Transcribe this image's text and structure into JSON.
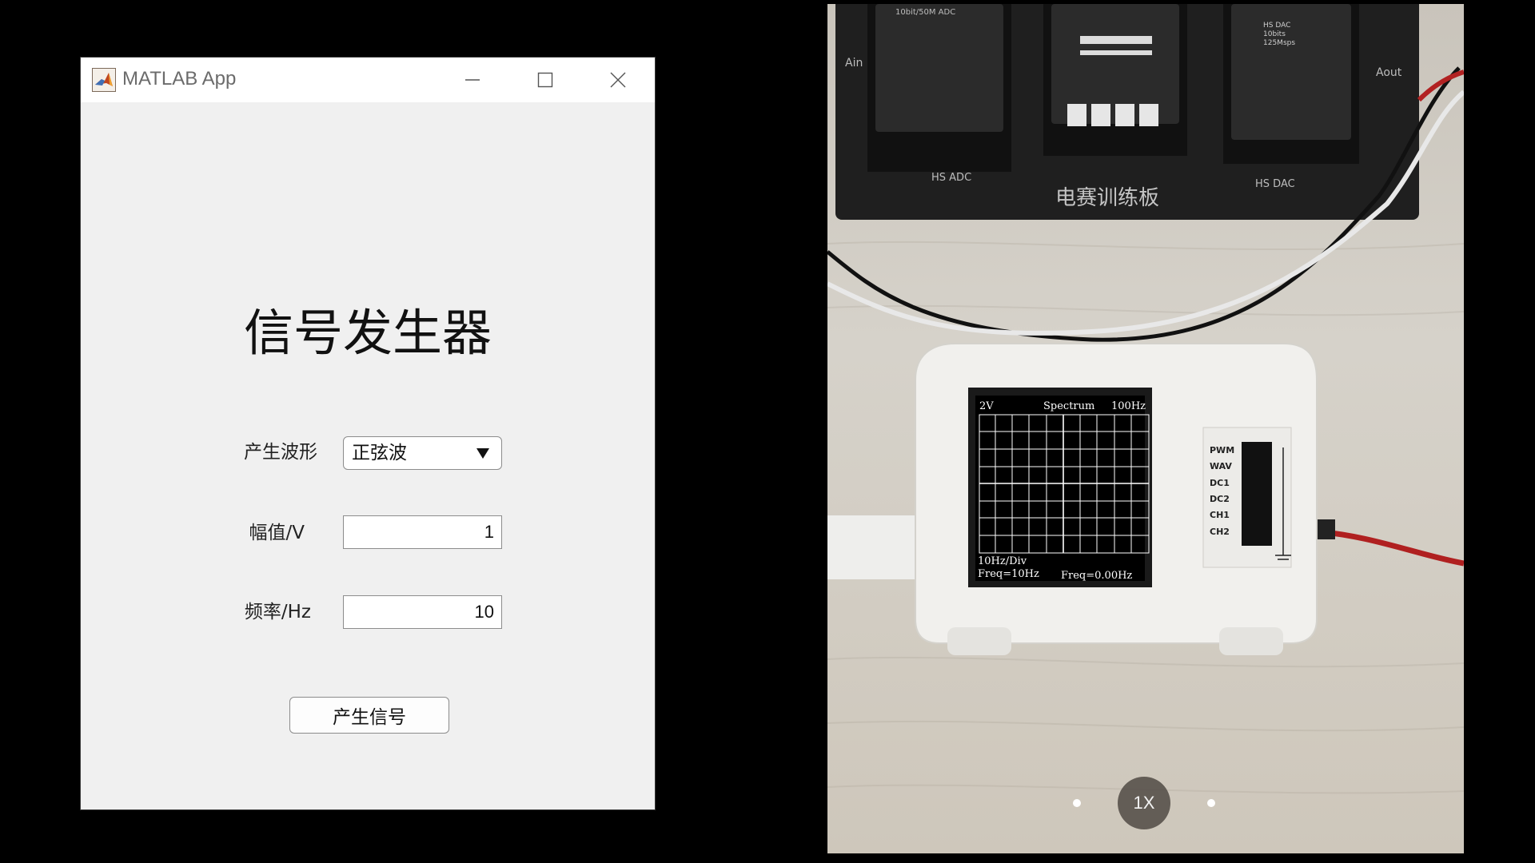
{
  "window": {
    "title": "MATLAB App",
    "minimize_icon": "minimize-icon",
    "maximize_icon": "maximize-icon",
    "close_icon": "close-icon"
  },
  "app": {
    "heading": "信号发生器",
    "waveform": {
      "label": "产生波形",
      "selected": "正弦波"
    },
    "amplitude": {
      "label": "幅值/V",
      "value": "1"
    },
    "frequency": {
      "label": "频率/Hz",
      "value": "10"
    },
    "generate_button": "产生信号"
  },
  "camera": {
    "zoom_label": "1X",
    "board": {
      "name": "电赛训练板",
      "adc_label": "HS ADC",
      "dac_label": "HS DAC",
      "ain": "Ain",
      "aout": "Aout",
      "adc_chip": "10bit/50M ADC",
      "dac_chip": [
        "HS DAC",
        "10bits",
        "125Msps"
      ]
    },
    "scope": {
      "volts": "2V",
      "mode": "Spectrum",
      "span": "100Hz",
      "div": "10Hz/Div",
      "freq_set": "Freq=10Hz",
      "freq_meas": "Freq=0.00Hz",
      "pins": [
        "PWM",
        "WAV",
        "DC1",
        "DC2",
        "CH1",
        "CH2"
      ]
    }
  },
  "colors": {
    "window_bg": "#f0f0f0",
    "titlebar_bg": "#ffffff",
    "screen_bg": "#000000",
    "grid": "#ffffff",
    "pcb": "#1f1f1f"
  }
}
